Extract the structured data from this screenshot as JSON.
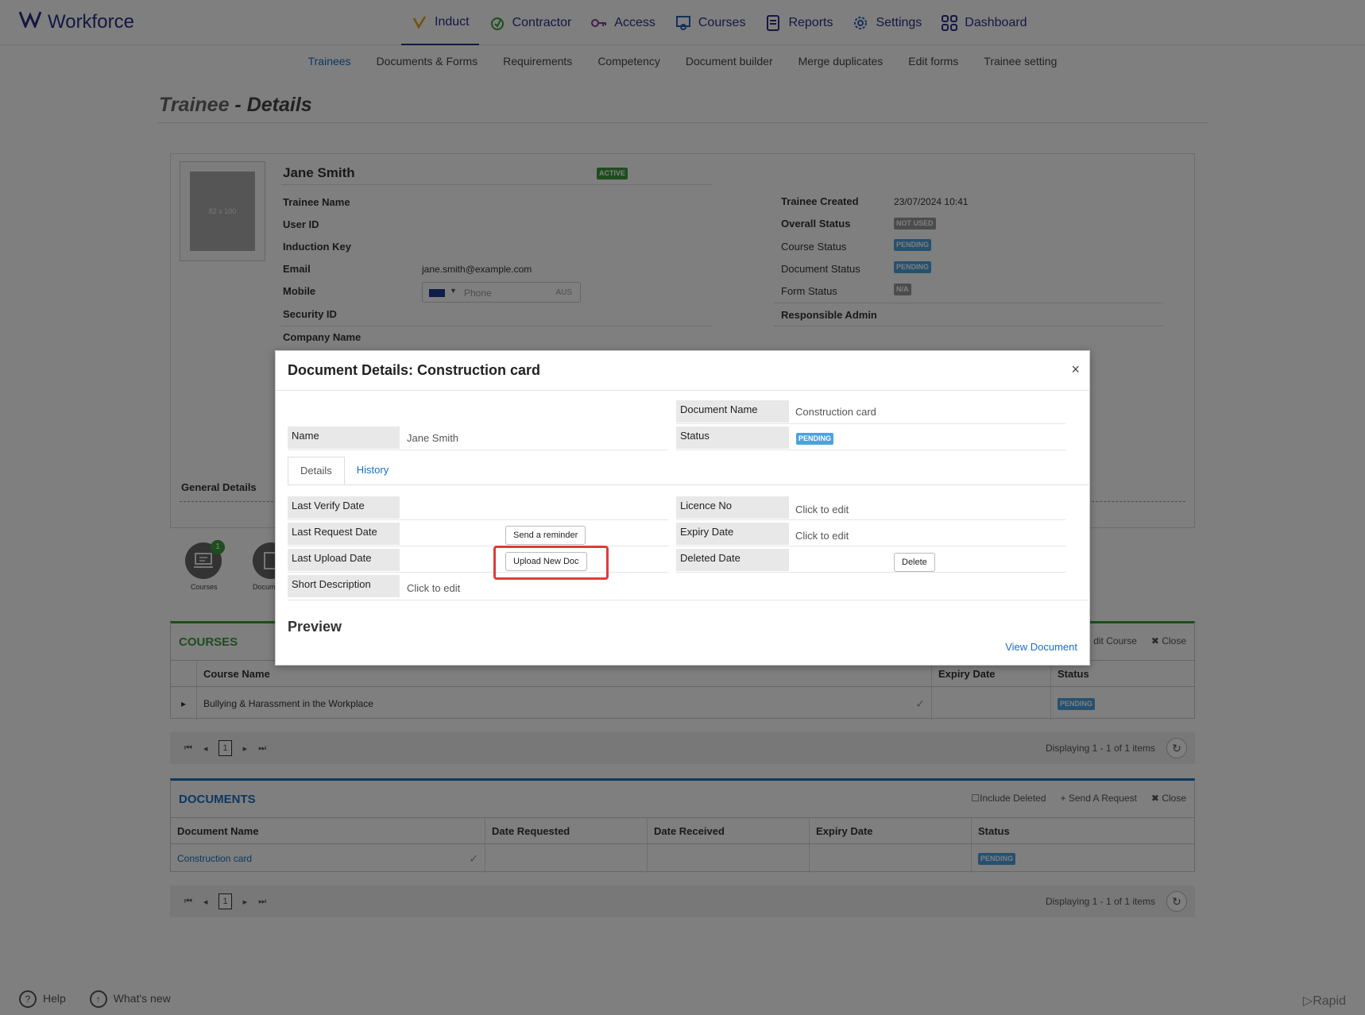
{
  "brand": {
    "name": "Workforce"
  },
  "nav": {
    "items": [
      {
        "label": "Induct",
        "icon": "induct-icon",
        "color": "#e3a21a"
      },
      {
        "label": "Contractor",
        "icon": "contractor-icon",
        "color": "#3c9a3c"
      },
      {
        "label": "Access",
        "icon": "key-icon",
        "color": "#8a3ca0"
      },
      {
        "label": "Courses",
        "icon": "courses-icon",
        "color": "#2b5fb5"
      },
      {
        "label": "Reports",
        "icon": "reports-icon",
        "color": "#2b2f86"
      },
      {
        "label": "Settings",
        "icon": "gear-icon",
        "color": "#2b5fb5"
      },
      {
        "label": "Dashboard",
        "icon": "dashboard-icon",
        "color": "#2b2f86"
      }
    ]
  },
  "subnav": [
    "Trainees",
    "Documents & Forms",
    "Requirements",
    "Competency",
    "Document builder",
    "Merge duplicates",
    "Edit forms",
    "Trainee setting"
  ],
  "page": {
    "title_a": "Trainee",
    "title_sep": " - ",
    "title_b": "Details"
  },
  "trainee": {
    "name": "Jane Smith",
    "status_badge": "ACTIVE",
    "photo_placeholder": "82 x 100",
    "labels": [
      "Trainee Name",
      "User ID",
      "Induction Key",
      "Email",
      "Mobile",
      "Security ID",
      "Company Name"
    ],
    "email": "jane.smith@example.com",
    "phone_placeholder": "Phone",
    "phone_country": "AUS",
    "right_labels": [
      "Trainee Created",
      "Overall Status",
      "Course Status",
      "Document Status",
      "Form Status",
      "Responsible Admin"
    ],
    "created": "23/07/2024 10:41",
    "overall_status": "NOT USED",
    "course_status": "PENDING",
    "document_status": "PENDING",
    "form_status": "N/A",
    "general_details": "General Details"
  },
  "quick": {
    "courses_label": "Courses",
    "courses_count": "1",
    "documents_label": "Docum"
  },
  "courses": {
    "title": "COURSES",
    "tools": [
      "dit Course",
      "Close"
    ],
    "columns": [
      "Course Name",
      "Expiry Date",
      "Status"
    ],
    "rows": [
      {
        "name": "Bullying & Harassment in the Workplace",
        "expiry": "",
        "status": "PENDING"
      }
    ],
    "page": "1",
    "display": "Displaying 1 - 1 of 1 items"
  },
  "documents": {
    "title": "DOCUMENTS",
    "tools": [
      "Include Deleted",
      "Send A Request",
      "Close"
    ],
    "columns": [
      "Document Name",
      "Date Requested",
      "Date Received",
      "Expiry Date",
      "Status"
    ],
    "rows": [
      {
        "name": "Construction card",
        "requested": "",
        "received": "",
        "expiry": "",
        "status": "PENDING"
      }
    ],
    "page": "1",
    "display": "Displaying 1 - 1 of 1 items"
  },
  "footer": {
    "help": "Help",
    "whats_new": "What's new",
    "rapid": "Rapid"
  },
  "modal": {
    "title": "Document Details: Construction card",
    "close": "×",
    "doc_name_label": "Document Name",
    "doc_name": "Construction card",
    "name_label": "Name",
    "name": "Jane Smith",
    "status_label": "Status",
    "status": "PENDING",
    "tabs": [
      "Details",
      "History"
    ],
    "left": [
      {
        "label": "Last Verify Date",
        "value": ""
      },
      {
        "label": "Last Request Date",
        "value": ""
      },
      {
        "label": "Last Upload Date",
        "value": ""
      },
      {
        "label": "Short Description",
        "value": "Click to edit"
      }
    ],
    "right": [
      {
        "label": "Licence No",
        "value": "Click to edit"
      },
      {
        "label": "Expiry Date",
        "value": "Click to edit"
      },
      {
        "label": "Deleted Date",
        "value": ""
      }
    ],
    "send_reminder": "Send a reminder",
    "upload_new": "Upload New Doc",
    "delete": "Delete",
    "preview": "Preview",
    "view_document": "View Document"
  },
  "colors": {
    "accent": "#2b2f86",
    "link": "#1a6fc1",
    "pending": "#4aa3df",
    "active": "#3c9a3c",
    "highlight": "#e03b3b",
    "courses_header": "#3c9a3c",
    "documents_header": "#1a6fc1"
  }
}
